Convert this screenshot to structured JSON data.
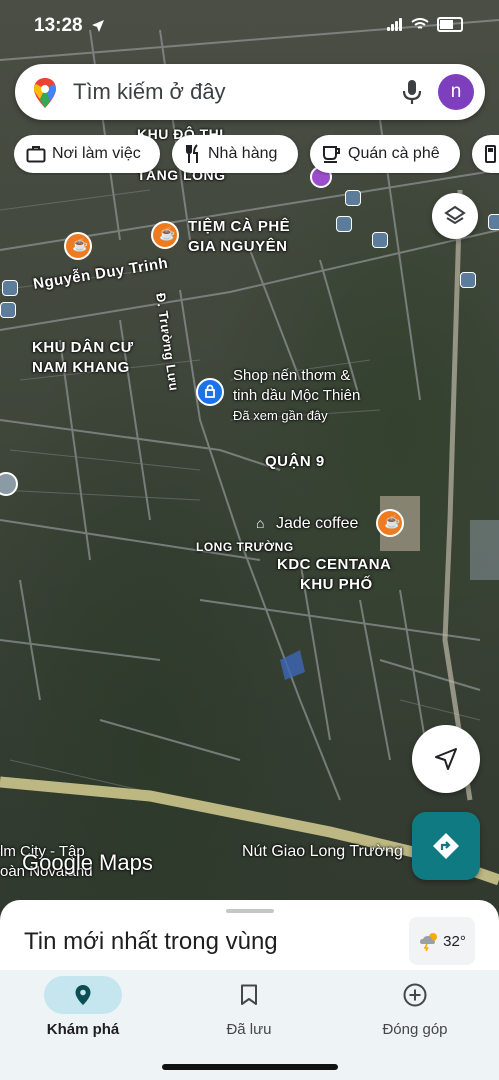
{
  "status_bar": {
    "time": "13:28"
  },
  "search": {
    "placeholder": "Tìm kiếm ở đây",
    "avatar_letter": "n"
  },
  "chips": [
    {
      "label": "Nơi làm việc",
      "icon": "briefcase-icon"
    },
    {
      "label": "Nhà hàng",
      "icon": "restaurant-icon"
    },
    {
      "label": "Quán cà phê",
      "icon": "coffee-icon"
    }
  ],
  "map_labels": {
    "khu_do_thi_1": "KHU ĐÔ THỊ",
    "khu_do_thi_2": "TĂNG LONG",
    "tiem_ca_phe_1": "TIỆM CÀ PHÊ",
    "tiem_ca_phe_2": "GIA NGUYÊN",
    "nguyen_duy_trinh": "Nguyễn Duy Trinh",
    "d_truong_luu": "Đ. Trường Lưu",
    "nam_khang_1": "KHU DÂN CƯ",
    "nam_khang_2": "NAM KHANG",
    "shop_1": "Shop nến thơm &",
    "shop_2": "tinh dầu Mộc Thiên",
    "shop_3": "Đã xem gần đây",
    "quan_9": "QUẬN 9",
    "jade_coffee": "Jade coffee",
    "long_truong": "LONG TRƯỜNG",
    "centana_1": "KDC CENTANA",
    "centana_2": "KHU PHỐ",
    "nut_giao": "Nút Giao Long Trường",
    "palm_1": "lm City - Tập",
    "palm_2": "oàn Novaland"
  },
  "watermark": "Google Maps",
  "sheet": {
    "title": "Tin mới nhất trong vùng",
    "temperature": "32°"
  },
  "nav": [
    {
      "label": "Khám phá",
      "icon": "explore-pin-icon",
      "active": true
    },
    {
      "label": "Đã lưu",
      "icon": "bookmark-icon",
      "active": false
    },
    {
      "label": "Đóng góp",
      "icon": "add-circle-icon",
      "active": false
    }
  ],
  "colors": {
    "accent": "#0f7a82",
    "cafe": "#f07b1e",
    "avatar": "#7e3fbf",
    "nav_pill": "#c5e6ee"
  }
}
